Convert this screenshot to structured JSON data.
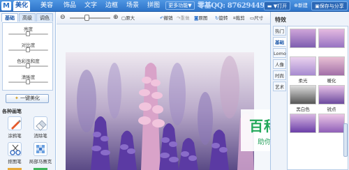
{
  "app": {
    "logo_glyph": "M",
    "main_tabs": [
      "美化",
      "美容",
      "饰品",
      "文字",
      "边框",
      "场景",
      "拼图"
    ],
    "active_main_tab": 0,
    "more_functions": "更多功能▼",
    "qq_watermark": "零基QQ: 87629449",
    "toolbar_right": {
      "open": "▼打开",
      "new": "新建",
      "save_share": "保存与分享"
    }
  },
  "left_panel": {
    "subtabs": [
      "基础",
      "高级",
      "调色"
    ],
    "active_subtab": 0,
    "sliders": [
      {
        "label": "亮度",
        "value": 0.5
      },
      {
        "label": "对比度",
        "value": 0.5
      },
      {
        "label": "色彩饱和度",
        "value": 0.5
      },
      {
        "label": "清晰度",
        "value": 0.5
      }
    ],
    "auto_beautify": "一键美化",
    "brush_section_title": "各种画笔",
    "brushes": [
      {
        "label": "涂鸦笔",
        "icon": "brush-icon"
      },
      {
        "label": "消除笔",
        "icon": "eraser-icon"
      },
      {
        "label": "抠图笔",
        "icon": "scissors-icon"
      },
      {
        "label": "局部马赛克",
        "icon": "mosaic-icon"
      }
    ]
  },
  "canvas": {
    "tools": [
      {
        "label": "原大",
        "icon": "original-size-icon",
        "disabled": false
      },
      {
        "label": "撤销",
        "icon": "undo-icon",
        "disabled": false
      },
      {
        "label": "重做",
        "icon": "redo-icon",
        "disabled": true
      },
      {
        "label": "原图",
        "icon": "original-image-icon",
        "disabled": false
      },
      {
        "label": "旋转",
        "icon": "rotate-icon",
        "disabled": false
      },
      {
        "label": "裁剪",
        "icon": "crop-icon",
        "disabled": false
      },
      {
        "label": "尺寸",
        "icon": "resize-icon",
        "disabled": false
      }
    ],
    "zoom_level": 0.55,
    "overlay": {
      "title": "百科全说",
      "subtitle": "助你轻松解决"
    }
  },
  "right_panel": {
    "title": "特效",
    "categories": [
      "热门",
      "基础",
      "Lomo",
      "人像",
      "时尚",
      "艺术"
    ],
    "active_category": 1,
    "effects": [
      {
        "label": ""
      },
      {
        "label": ""
      },
      {
        "label": "柔光"
      },
      {
        "label": "暖化"
      },
      {
        "label": "黑白色"
      },
      {
        "label": "锐点"
      },
      {
        "label": ""
      },
      {
        "label": ""
      }
    ]
  },
  "colors": {
    "topbar": "#2e74c9",
    "panel_bg": "#eef3fa",
    "accent_green": "#22a85a"
  }
}
